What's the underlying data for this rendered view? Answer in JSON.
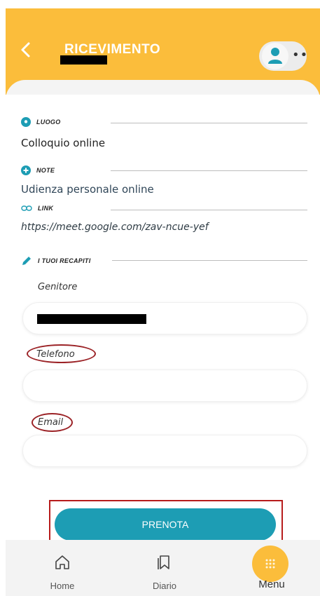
{
  "header": {
    "title": "RICEVIMENTO"
  },
  "luogo": {
    "label": "LUOGO",
    "value": "Colloquio online"
  },
  "note": {
    "label": "NOTE",
    "value": "Udienza personale online"
  },
  "link": {
    "label": "LINK",
    "value": "https://meet.google.com/zav-ncue-yef"
  },
  "recapiti": {
    "label": "I TUOI RECAPITI",
    "genitore_label": "Genitore",
    "telefono_label": "Telefono",
    "email_label": "Email"
  },
  "action": {
    "submit_label": "PRENOTA"
  },
  "nav": {
    "home": "Home",
    "diario": "Diario",
    "menu": "Menu"
  },
  "colors": {
    "header": "#fbbd3b",
    "primary_button": "#1d9db4",
    "icon": "#1d9db4",
    "annotation": "#9b2226"
  },
  "icons": [
    "back-arrow-icon",
    "user-icon",
    "location-pin-icon",
    "plus-circle-icon",
    "link-icon",
    "pencil-icon",
    "home-icon",
    "bookmark-icon",
    "grid-dots-icon"
  ]
}
